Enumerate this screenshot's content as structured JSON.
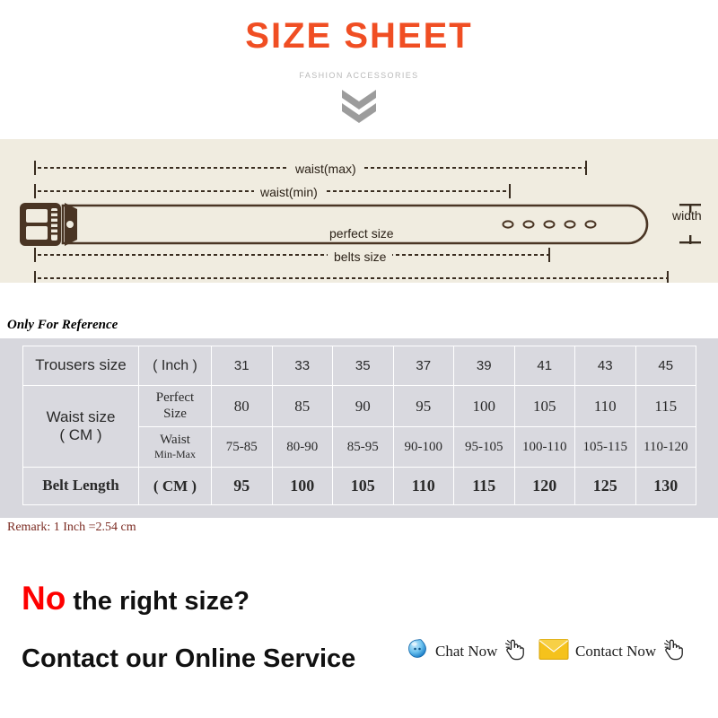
{
  "header": {
    "title": "SIZE SHEET",
    "subtitle": "FASHION ACCESSORIES",
    "title_color": "#f04e23",
    "subtitle_color": "#b9b9b9",
    "chevron_icon": "chevron-double-down-icon"
  },
  "belt_diagram": {
    "background_color": "#f0ece0",
    "belt_color": "#4a3524",
    "labels": {
      "waist_max": "waist(max)",
      "waist_min": "waist(min)",
      "perfect_size": "perfect size",
      "belts_size": "belts size",
      "width": "width"
    },
    "hole_count": 5
  },
  "table_section": {
    "note": "Only For Reference",
    "remark": "Remark: 1 Inch =2.54 cm",
    "remark_color": "#7b2b22",
    "background_color": "#d7d7dd",
    "rows": {
      "trousers_label": "Trousers size",
      "trousers_unit": "( Inch )",
      "trousers_values": [
        "31",
        "33",
        "35",
        "37",
        "39",
        "41",
        "43",
        "45"
      ],
      "waist_label_line1": "Waist size",
      "waist_label_line2": "( CM )",
      "perfect_unit_line1": "Perfect",
      "perfect_unit_line2": "Size",
      "perfect_values": [
        "80",
        "85",
        "90",
        "95",
        "100",
        "105",
        "110",
        "115"
      ],
      "waist_unit_line1": "Waist",
      "waist_unit_line2": "Min-Max",
      "waist_values": [
        "75-85",
        "80-90",
        "85-95",
        "90-100",
        "95-105",
        "100-110",
        "105-115",
        "110-120"
      ],
      "belt_label": "Belt Length",
      "belt_unit": "( CM )",
      "belt_values": [
        "95",
        "100",
        "105",
        "110",
        "115",
        "120",
        "125",
        "130"
      ]
    }
  },
  "footer": {
    "no_word": "No",
    "no_word_color": "#fe0000",
    "right_size_text": " the right size?",
    "contact_text": "Contact our Online Service",
    "chat_label": "Chat Now",
    "chat_icon": "chat-bubble-icon",
    "contact_label": "Contact Now",
    "contact_icon": "envelope-icon",
    "pointer_icon": "pointing-hand-icon"
  }
}
